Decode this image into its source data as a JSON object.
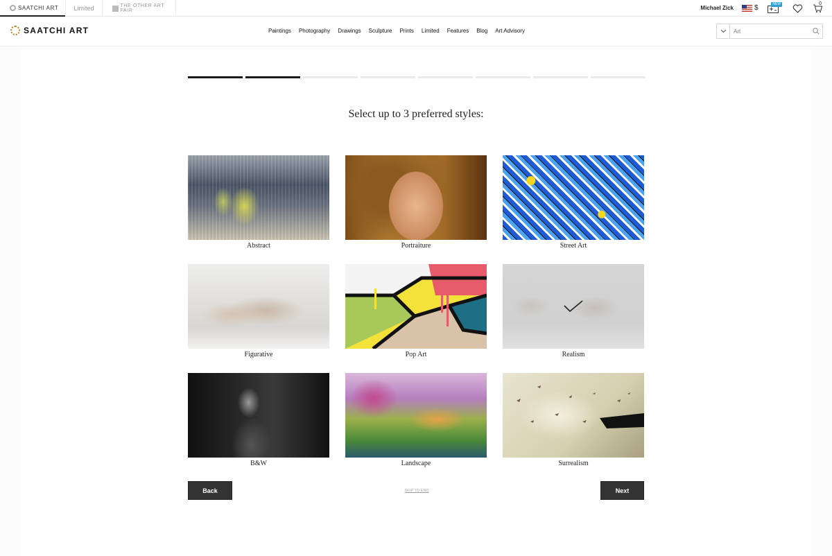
{
  "topbar": {
    "tabs": [
      {
        "label": "SAATCHI ART"
      },
      {
        "label": "Limited"
      },
      {
        "label": "THE OTHER ART FAIR"
      }
    ],
    "user_name": "Michael Zick",
    "currency": "$",
    "new_badge": "NEW",
    "cart_count": "0"
  },
  "header": {
    "logo_text": "SAATCHI ART",
    "nav": [
      "Paintings",
      "Photography",
      "Drawings",
      "Sculpture",
      "Prints",
      "Limited",
      "Features",
      "Blog",
      "Art Advisory"
    ],
    "search_placeholder": "Art"
  },
  "quiz": {
    "progress_total": 8,
    "progress_done": 2,
    "question": "Select up to 3 preferred styles:",
    "styles": [
      {
        "label": "Abstract",
        "selected": false
      },
      {
        "label": "Portraiture",
        "selected": false
      },
      {
        "label": "Street Art",
        "selected": false
      },
      {
        "label": "Figurative",
        "selected": false
      },
      {
        "label": "Pop Art",
        "selected": false
      },
      {
        "label": "Realism",
        "selected": true
      },
      {
        "label": "B&W",
        "selected": false
      },
      {
        "label": "Landscape",
        "selected": false
      },
      {
        "label": "Surrealism",
        "selected": false
      }
    ],
    "back_label": "Back",
    "next_label": "Next",
    "skip_label": "SKIP TO END"
  },
  "colors": {
    "accent_logo": "#b9862b",
    "progress_done": "#1a1a1a",
    "progress_todo": "#eaeaea",
    "button_bg": "#333333"
  }
}
